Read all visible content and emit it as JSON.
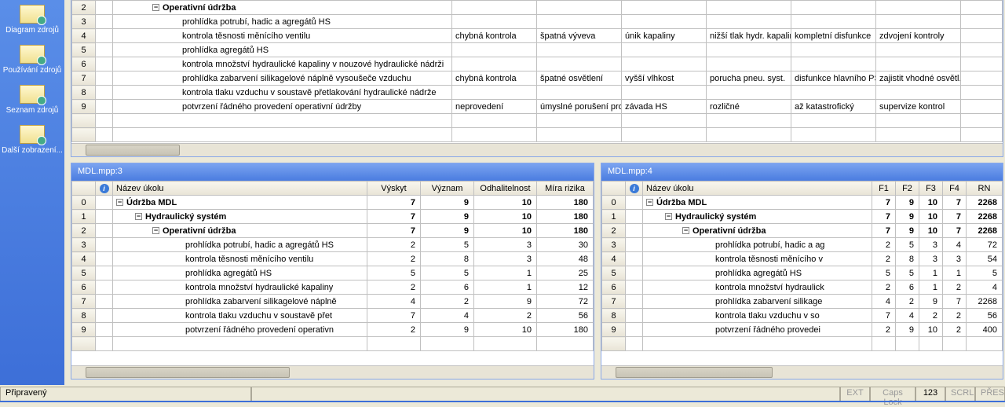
{
  "sidebar": {
    "items": [
      {
        "label": "Diagram zdrojů"
      },
      {
        "label": "Používání zdrojů"
      },
      {
        "label": "Seznam zdrojů"
      },
      {
        "label": "Další zobrazení..."
      }
    ]
  },
  "topGrid": {
    "rows": [
      {
        "n": "2",
        "task": "Operativní údržba",
        "bold": true,
        "indent": 2,
        "collapse": true,
        "c": [
          "",
          "",
          "",
          "",
          "",
          ""
        ]
      },
      {
        "n": "3",
        "task": "prohlídka potrubí, hadic a agregátů HS",
        "indent": 3,
        "c": [
          "",
          "",
          "",
          "",
          "",
          ""
        ]
      },
      {
        "n": "4",
        "task": "kontrola těsnosti měnícího ventilu",
        "indent": 3,
        "c": [
          "chybná kontrola",
          "špatná výveva",
          "únik kapaliny",
          "nižší tlak hydr. kapalin",
          "kompletní disfunkce",
          "zdvojení kontroly"
        ]
      },
      {
        "n": "5",
        "task": "prohlídka agregátů HS",
        "indent": 3,
        "c": [
          "",
          "",
          "",
          "",
          "",
          ""
        ]
      },
      {
        "n": "6",
        "task": "kontrola množství hydraulické kapaliny v nouzové hydraulické nádrži",
        "indent": 3,
        "c": [
          "",
          "",
          "",
          "",
          "",
          ""
        ]
      },
      {
        "n": "7",
        "task": "prohlídka zabarvení silikagelové náplně vysoušeče vzduchu",
        "indent": 3,
        "c": [
          "chybná kontrola",
          "špatné osvětlení",
          "vyšší vlhkost",
          "porucha pneu. syst.",
          "disfunkce hlavního PS",
          "zajistit vhodné osvětl."
        ]
      },
      {
        "n": "8",
        "task": "kontrola tlaku vzduchu v soustavě přetlakování hydraulické nádrže",
        "indent": 3,
        "c": [
          "",
          "",
          "",
          "",
          "",
          ""
        ]
      },
      {
        "n": "9",
        "task": "potvrzení řádného provedení operativní údržby",
        "indent": 3,
        "c": [
          "neprovedení",
          "úmyslné porušení prov",
          "závada HS",
          "rozličné",
          "až katastrofický",
          "supervize kontrol"
        ]
      },
      {
        "n": "",
        "task": "",
        "c": [
          "",
          "",
          "",
          "",
          "",
          ""
        ]
      },
      {
        "n": "",
        "task": "",
        "c": [
          "",
          "",
          "",
          "",
          "",
          ""
        ]
      }
    ]
  },
  "paneBL": {
    "title": "MDL.mpp:3",
    "headers": [
      "Název úkolu",
      "Výskyt",
      "Význam",
      "Odhalitelnost",
      "Míra rizika"
    ],
    "rows": [
      {
        "n": "0",
        "task": "Údržba MDL",
        "bold": true,
        "indent": 0,
        "collapse": true,
        "v": [
          "7",
          "9",
          "10",
          "180"
        ]
      },
      {
        "n": "1",
        "task": "Hydraulický systém",
        "bold": true,
        "indent": 1,
        "collapse": true,
        "v": [
          "7",
          "9",
          "10",
          "180"
        ]
      },
      {
        "n": "2",
        "task": "Operativní údržba",
        "bold": true,
        "indent": 2,
        "collapse": true,
        "v": [
          "7",
          "9",
          "10",
          "180"
        ]
      },
      {
        "n": "3",
        "task": "prohlídka potrubí, hadic a agregátů HS",
        "indent": 3,
        "v": [
          "2",
          "5",
          "3",
          "30"
        ]
      },
      {
        "n": "4",
        "task": "kontrola těsnosti měnícího ventilu",
        "indent": 3,
        "v": [
          "2",
          "8",
          "3",
          "48"
        ]
      },
      {
        "n": "5",
        "task": "prohlídka agregátů HS",
        "indent": 3,
        "v": [
          "5",
          "5",
          "1",
          "25"
        ]
      },
      {
        "n": "6",
        "task": "kontrola množství hydraulické kapaliny",
        "indent": 3,
        "v": [
          "2",
          "6",
          "1",
          "12"
        ]
      },
      {
        "n": "7",
        "task": "prohlídka zabarvení silikagelové náplně",
        "indent": 3,
        "v": [
          "4",
          "2",
          "9",
          "72"
        ]
      },
      {
        "n": "8",
        "task": "kontrola tlaku vzduchu v soustavě přet",
        "indent": 3,
        "v": [
          "7",
          "4",
          "2",
          "56"
        ]
      },
      {
        "n": "9",
        "task": "potvrzení řádného provedení operativn",
        "indent": 3,
        "v": [
          "2",
          "9",
          "10",
          "180"
        ]
      },
      {
        "n": "",
        "task": "",
        "v": [
          "",
          "",
          "",
          ""
        ]
      }
    ]
  },
  "paneBR": {
    "title": "MDL.mpp:4",
    "headers": [
      "Název úkolu",
      "F1",
      "F2",
      "F3",
      "F4",
      "RN"
    ],
    "rows": [
      {
        "n": "0",
        "task": "Údržba MDL",
        "bold": true,
        "indent": 0,
        "collapse": true,
        "v": [
          "7",
          "9",
          "10",
          "7",
          "2268"
        ]
      },
      {
        "n": "1",
        "task": "Hydraulický systém",
        "bold": true,
        "indent": 1,
        "collapse": true,
        "v": [
          "7",
          "9",
          "10",
          "7",
          "2268"
        ]
      },
      {
        "n": "2",
        "task": "Operativní údržba",
        "bold": true,
        "indent": 2,
        "collapse": true,
        "v": [
          "7",
          "9",
          "10",
          "7",
          "2268"
        ]
      },
      {
        "n": "3",
        "task": "prohlídka potrubí, hadic a ag",
        "indent": 3,
        "v": [
          "2",
          "5",
          "3",
          "4",
          "72"
        ]
      },
      {
        "n": "4",
        "task": "kontrola těsnosti měnícího v",
        "indent": 3,
        "v": [
          "2",
          "8",
          "3",
          "3",
          "54"
        ]
      },
      {
        "n": "5",
        "task": "prohlídka agregátů HS",
        "indent": 3,
        "v": [
          "5",
          "5",
          "1",
          "1",
          "5"
        ]
      },
      {
        "n": "6",
        "task": "kontrola množství hydraulick",
        "indent": 3,
        "v": [
          "2",
          "6",
          "1",
          "2",
          "4"
        ]
      },
      {
        "n": "7",
        "task": "prohlídka zabarvení silikage",
        "indent": 3,
        "v": [
          "4",
          "2",
          "9",
          "7",
          "2268"
        ]
      },
      {
        "n": "8",
        "task": "kontrola tlaku vzduchu v so",
        "indent": 3,
        "v": [
          "7",
          "4",
          "2",
          "2",
          "56"
        ]
      },
      {
        "n": "9",
        "task": "potvrzení řádného provedei",
        "indent": 3,
        "v": [
          "2",
          "9",
          "10",
          "2",
          "400"
        ]
      },
      {
        "n": "",
        "task": "",
        "v": [
          "",
          "",
          "",
          "",
          ""
        ]
      }
    ]
  },
  "statusbar": {
    "ready": "Připravený",
    "indicators": [
      "EXT",
      "Caps Lock",
      "123",
      "SCRL",
      "PŘES"
    ]
  }
}
